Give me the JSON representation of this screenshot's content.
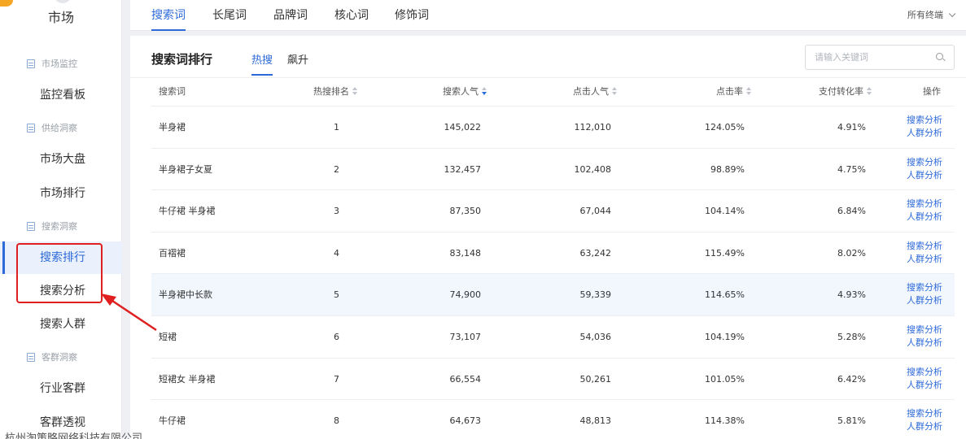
{
  "sidebar": {
    "title": "市场",
    "sections": [
      {
        "label": "市场监控",
        "items": [
          "监控看板"
        ]
      },
      {
        "label": "供给洞察",
        "items": [
          "市场大盘",
          "市场排行"
        ]
      },
      {
        "label": "搜索洞察",
        "items": [
          "搜索排行",
          "搜索分析",
          "搜索人群"
        ]
      },
      {
        "label": "客群洞察",
        "items": [
          "行业客群",
          "客群透视"
        ]
      }
    ],
    "active_item": "搜索排行"
  },
  "top_tabs": [
    "搜索词",
    "长尾词",
    "品牌词",
    "核心词",
    "修饰词"
  ],
  "active_top_tab": "搜索词",
  "terminal_select": "所有终端",
  "panel": {
    "title": "搜索词排行",
    "subtabs": [
      "热搜",
      "飙升"
    ],
    "active_subtab": "热搜",
    "search_placeholder": "请输入关键词"
  },
  "table": {
    "columns": [
      "搜索词",
      "热搜排名",
      "搜索人气",
      "点击人气",
      "点击率",
      "支付转化率",
      "操作"
    ],
    "sorted_column": "搜索人气",
    "sort_direction": "desc",
    "rows": [
      {
        "kw": "半身裙",
        "rank": "1",
        "search": "145,022",
        "click": "112,010",
        "ctr": "124.05%",
        "conv": "4.91%"
      },
      {
        "kw": "半身裙子女夏",
        "rank": "2",
        "search": "132,457",
        "click": "102,408",
        "ctr": "98.89%",
        "conv": "4.75%"
      },
      {
        "kw": "牛仔裙 半身裙",
        "rank": "3",
        "search": "87,350",
        "click": "67,044",
        "ctr": "104.14%",
        "conv": "6.84%"
      },
      {
        "kw": "百褶裙",
        "rank": "4",
        "search": "83,148",
        "click": "63,242",
        "ctr": "115.49%",
        "conv": "8.02%"
      },
      {
        "kw": "半身裙中长款",
        "rank": "5",
        "search": "74,900",
        "click": "59,339",
        "ctr": "114.65%",
        "conv": "4.93%"
      },
      {
        "kw": "短裙",
        "rank": "6",
        "search": "73,107",
        "click": "54,036",
        "ctr": "104.19%",
        "conv": "5.28%"
      },
      {
        "kw": "短裙女 半身裙",
        "rank": "7",
        "search": "66,554",
        "click": "50,261",
        "ctr": "101.05%",
        "conv": "6.42%"
      },
      {
        "kw": "牛仔裙",
        "rank": "8",
        "search": "64,673",
        "click": "48,813",
        "ctr": "114.38%",
        "conv": "5.81%"
      }
    ],
    "highlighted_row": 5,
    "ops": [
      "搜索分析",
      "人群分析"
    ]
  },
  "watermark": "杭州淘策略网络科技有限公司",
  "colors": {
    "accent": "#2d6ad9",
    "annotation": "#e02020",
    "row_highlight": "#f2f7fe"
  }
}
